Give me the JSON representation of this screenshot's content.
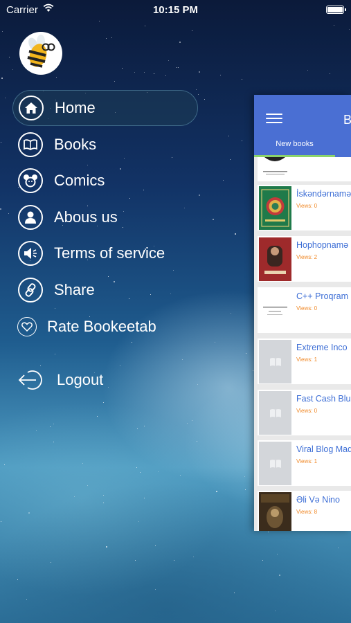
{
  "status_bar": {
    "carrier": "Carrier",
    "time": "10:15 PM",
    "icons": [
      "wifi-icon",
      "battery-icon"
    ]
  },
  "profile": {
    "avatar_icon": "bee-logo"
  },
  "menu": {
    "items": [
      {
        "label": "Home",
        "icon": "home-icon",
        "active": true
      },
      {
        "label": "Books",
        "icon": "book-icon",
        "active": false
      },
      {
        "label": "Comics",
        "icon": "mickey-icon",
        "active": false
      },
      {
        "label": "Abous us",
        "icon": "person-icon",
        "active": false
      },
      {
        "label": "Terms of service",
        "icon": "speaker-icon",
        "active": false
      },
      {
        "label": "Share",
        "icon": "share-link-icon",
        "active": false
      },
      {
        "label": "Rate Bookeetab",
        "icon": "heart-icon",
        "active": false
      }
    ],
    "logout": {
      "label": "Logout",
      "icon": "logout-arrow-icon"
    }
  },
  "preview_panel": {
    "title": "B",
    "tab_label": "New books",
    "books": [
      {
        "title": "İskəndərnamə",
        "views": "Views: 0",
        "cover": "green-cover"
      },
      {
        "title": "Hophopnamə",
        "views": "Views: 2",
        "cover": "red-cover"
      },
      {
        "title": "C++ Proqram",
        "views": "Views: 0",
        "cover": "white-cover"
      },
      {
        "title": "Extreme Inco",
        "views": "Views: 1",
        "cover": "placeholder"
      },
      {
        "title": "Fast Cash Blu",
        "views": "Views: 0",
        "cover": "placeholder"
      },
      {
        "title": "Viral Blog Mad",
        "views": "Views: 1",
        "cover": "placeholder"
      },
      {
        "title": "Əli Və Nino",
        "views": "Views: 8",
        "cover": "dark-cover"
      }
    ]
  },
  "colors": {
    "header_blue": "#4a6fd3",
    "title_blue": "#3e6fd6",
    "views_orange": "#f08a2a",
    "tab_underline_green": "#8bd36b"
  }
}
